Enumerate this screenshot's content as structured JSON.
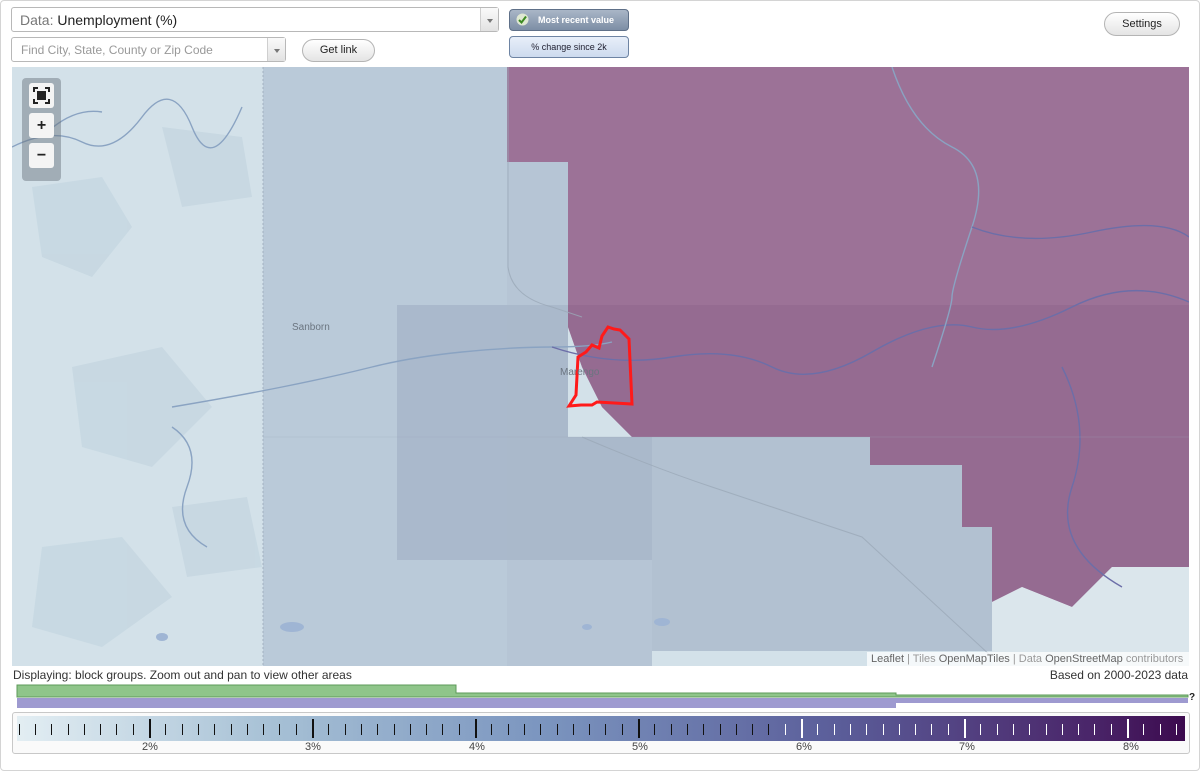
{
  "toolbar": {
    "data_label": "Data:",
    "data_value": "Unemployment (%)",
    "search_placeholder": "Find City, State, County or Zip Code",
    "get_link": "Get link",
    "mode_recent": "Most recent value",
    "mode_change": "% change since 2k",
    "settings": "Settings"
  },
  "map": {
    "place_labels": [
      "Sanborn",
      "Marengo"
    ],
    "zoom_in": "+",
    "zoom_out": "−",
    "attribution": {
      "leaflet": "Leaflet",
      "sep1": "| Tiles",
      "tiles": "OpenMapTiles",
      "sep2": "| Data",
      "osm": "OpenStreetMap",
      "contributors": "contributors"
    }
  },
  "footer": {
    "display_note": "Displaying: block groups. Zoom out and pan to view other areas",
    "based_on": "Based on 2000-2023 data",
    "histogram_unknown": "?"
  },
  "legend": {
    "ticks": [
      "2%",
      "3%",
      "4%",
      "5%",
      "6%",
      "7%",
      "8%"
    ]
  },
  "colors": {
    "highlight_outline": "#ff0000",
    "high_region": "#9a6f96",
    "low_region": "#b3c2d2",
    "histogram_green": "#8fc58a",
    "histogram_purple": "#9e9ad0"
  }
}
